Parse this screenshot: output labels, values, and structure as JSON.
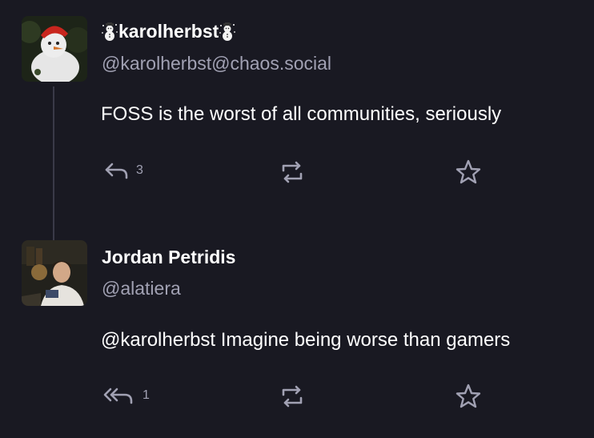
{
  "posts": [
    {
      "display_name": "karolherbst",
      "name_emoji": "snowman-icon",
      "handle": "@karolherbst@chaos.social",
      "content": "FOSS is the worst of all communities, seriously",
      "actions": {
        "reply_icon": "reply-icon",
        "reply_count": "3",
        "boost_icon": "boost-icon",
        "favourite_icon": "star-icon"
      }
    },
    {
      "display_name": "Jordan Petridis",
      "handle": "@alatiera",
      "content": "@karolherbst Imagine being worse than gamers",
      "actions": {
        "reply_icon": "reply-all-icon",
        "reply_count": "1",
        "boost_icon": "boost-icon",
        "favourite_icon": "star-icon"
      }
    }
  ],
  "colors": {
    "background": "#191922",
    "text": "#ffffff",
    "muted": "#a1a1b3",
    "thread_line": "#3a3a48"
  }
}
